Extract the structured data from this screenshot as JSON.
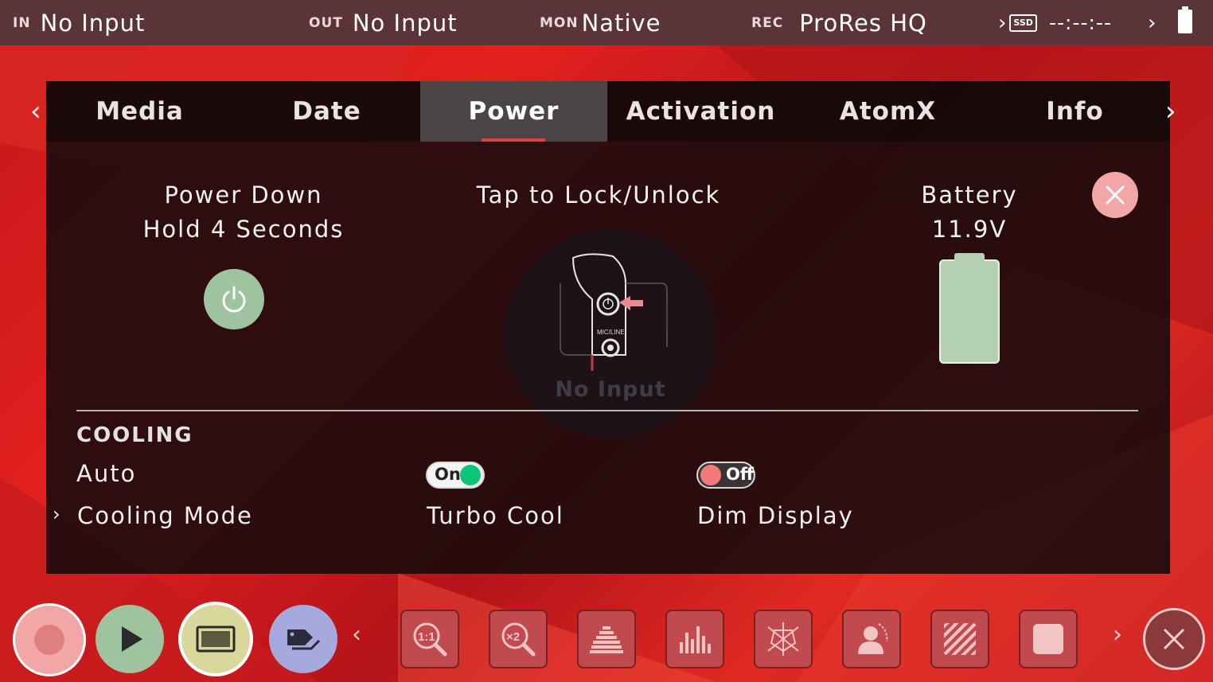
{
  "status_bar": {
    "in_label": "IN",
    "in_value": "No Input",
    "out_label": "OUT",
    "out_value": "No Input",
    "mon_label": "MON",
    "mon_value": "Native",
    "rec_label": "REC",
    "rec_value": "ProRes HQ",
    "ssd_label": "SSD",
    "timecode": "--:--:--"
  },
  "tabs": [
    {
      "label": "Media"
    },
    {
      "label": "Date"
    },
    {
      "label": "Power"
    },
    {
      "label": "Activation"
    },
    {
      "label": "AtomX"
    },
    {
      "label": "Info"
    }
  ],
  "active_tab": "Power",
  "power": {
    "power_down_line1": "Power Down",
    "power_down_line2": "Hold 4 Seconds",
    "lock_label": "Tap to Lock/Unlock",
    "lock_port_label": "MIC/LINE",
    "lock_ghost_text": "No Input",
    "battery_label": "Battery",
    "battery_voltage": "11.9V"
  },
  "cooling": {
    "title": "COOLING",
    "auto_label": "Auto",
    "cooling_mode_label": "Cooling Mode",
    "turbo_cool": {
      "label": "Turbo Cool",
      "state": "On"
    },
    "dim_display": {
      "label": "Dim Display",
      "state": "Off"
    }
  },
  "toolbar": {
    "record_color": "#f2a6a6",
    "play_color": "#9fc29f",
    "monitor_color": "#d9d79a",
    "tag_color": "#a6a9dd",
    "tools": [
      "zoom-1-1-icon",
      "zoom-x2-icon",
      "waveform-icon",
      "histogram-icon",
      "vectorscope-icon",
      "skin-tone-icon",
      "zebra-icon",
      "false-color-icon"
    ]
  },
  "colors": {
    "accent_red": "#e0403f",
    "toggle_on": "#0bc67a",
    "toggle_off": "#f07a7a"
  }
}
